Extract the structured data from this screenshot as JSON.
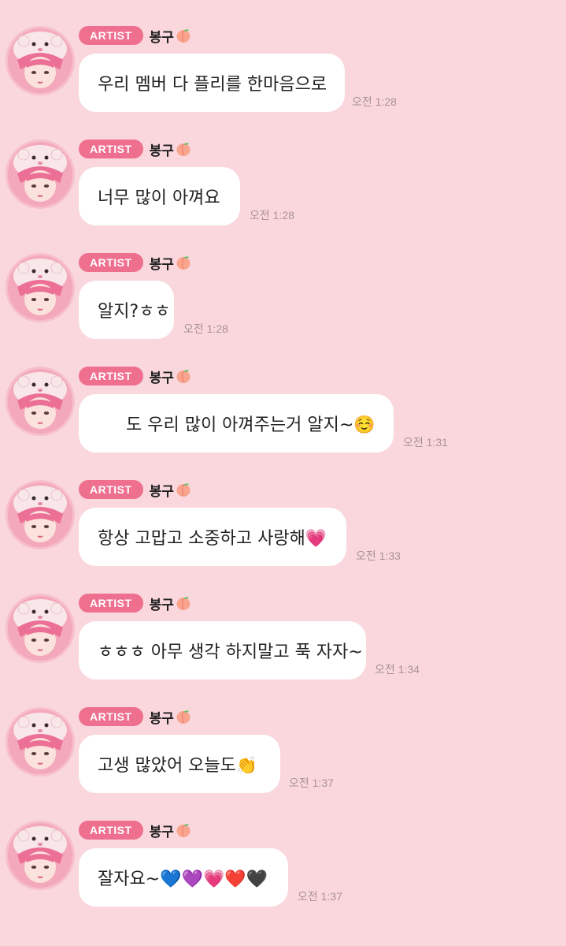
{
  "badge_label": "ARTIST",
  "artist_name": "봉구",
  "messages": [
    {
      "text": "우리 멤버 다 플리를 한마음으로",
      "time": "오전 1:28"
    },
    {
      "text": "너무 많이 아껴요",
      "time": "오전 1:28"
    },
    {
      "text": "알지?ㅎㅎ",
      "time": "오전 1:28"
    },
    {
      "text": "도 우리 많이 아껴주는거 알지~☺️",
      "time": "오전 1:31"
    },
    {
      "text": "항상 고맙고 소중하고 사랑해💗",
      "time": "오전 1:33"
    },
    {
      "text": "ㅎㅎㅎ 아무 생각 하지말고 푹 자자~",
      "time": "오전 1:34"
    },
    {
      "text": "고생 많았어 오늘도👏",
      "time": "오전 1:37"
    },
    {
      "text": "잘자요~💙💜💗❤️🖤",
      "time": "오전 1:37"
    }
  ],
  "colors": {
    "background": "#f9d7dd",
    "badge": "#ef6f8f",
    "bubble": "#ffffff",
    "time": "#a89396"
  },
  "icons": {
    "avatar": "artist-avatar-pink-hat",
    "name_emoji": "peach-icon"
  }
}
